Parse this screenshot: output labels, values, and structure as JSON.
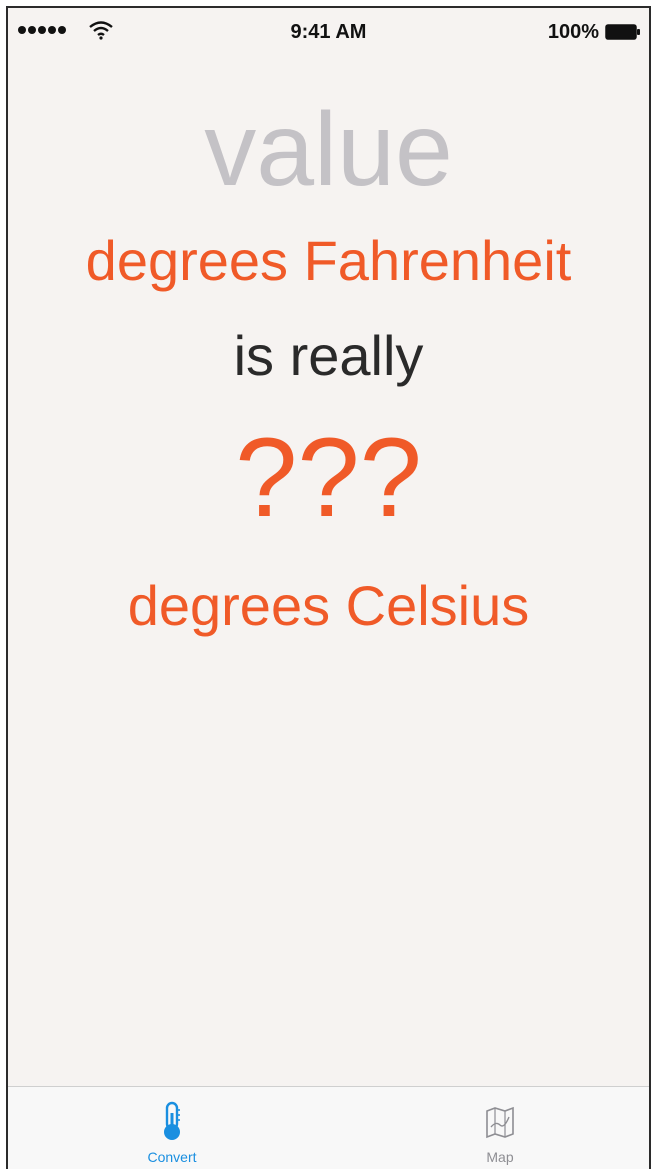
{
  "status_bar": {
    "time": "9:41 AM",
    "battery_percent": "100%",
    "signal_icon": "signal-dots-icon",
    "wifi_icon": "wifi-icon",
    "battery_icon": "battery-icon"
  },
  "converter": {
    "value_placeholder": "value",
    "fahrenheit_label": "degrees Fahrenheit",
    "connector_text": "is really",
    "result_value": "???",
    "celsius_label": "degrees Celsius"
  },
  "tab_bar": {
    "tabs": [
      {
        "label": "Convert",
        "icon": "thermometer-icon",
        "selected": true
      },
      {
        "label": "Map",
        "icon": "map-icon",
        "selected": false
      }
    ]
  },
  "colors": {
    "accent": "#f05a28",
    "placeholder": "#c4c2c6",
    "text": "#2a2a2a",
    "tab_selected": "#1a8fe0",
    "tab_unselected": "#8e8e93",
    "background": "#f6f3f1"
  }
}
